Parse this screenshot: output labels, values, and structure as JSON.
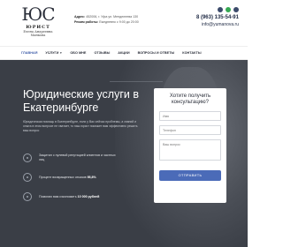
{
  "logo": {
    "mark": "ЮС",
    "name": "ЮРИСТ",
    "sub_line1": "Елена Андреевна",
    "sub_line2": "Манкова"
  },
  "contacts": {
    "address_label": "Адрес:",
    "address_value": "452006, г. Уфа ул. Менделеева 130",
    "hours_label": "Режим работы:",
    "hours_value": "Ежедневно с 9:00 до 20:00"
  },
  "header": {
    "phone": "8 (963) 135-54-91",
    "email": "info@yumanova.ru"
  },
  "nav": {
    "items": [
      {
        "label": "Главная",
        "active": true,
        "caret": false
      },
      {
        "label": "Услуги",
        "active": false,
        "caret": true
      },
      {
        "label": "Обо мне",
        "active": false,
        "caret": false
      },
      {
        "label": "Отзывы",
        "active": false,
        "caret": false
      },
      {
        "label": "Акции",
        "active": false,
        "caret": false
      },
      {
        "label": "Вопросы и ответы",
        "active": false,
        "caret": false
      },
      {
        "label": "Контакты",
        "active": false,
        "caret": false
      }
    ]
  },
  "hero": {
    "title": "Юридические услуги в Екатеринбурге",
    "text": "Юридическая помощь в Екатеринбурге, если у Вас сейчас проблемы, а знаний и опыта в этом вопросе не хватает, то наш юрист поможет вам эффективно решить ваш вопрос"
  },
  "features": [
    {
      "text_before": "Защитил с нулевой репутацией ",
      "strong": "",
      "text_after": "клиентов и частных лиц"
    },
    {
      "text_before": "Процент возвращенных отказов ",
      "strong": "95,8%",
      "text_after": ""
    },
    {
      "text_before": "Помогаю вам сэкономить ",
      "strong": "10 000 рублей",
      "text_after": ""
    }
  ],
  "form": {
    "title": "Хотите получить консультацию?",
    "name_placeholder": "Имя",
    "phone_placeholder": "Телефон",
    "question_placeholder": "Ваш вопрос",
    "submit_label": "Отправить"
  },
  "colors": {
    "accent": "#4b6bb8",
    "hero_bg": "#3a3e46",
    "nav_active": "#3c5ba8"
  }
}
